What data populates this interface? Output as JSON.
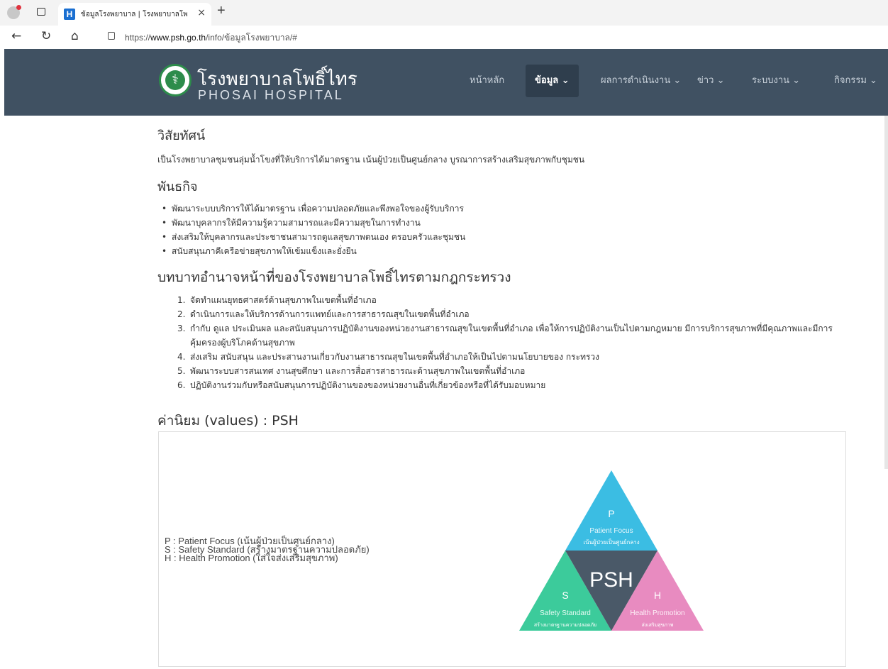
{
  "browser": {
    "tab_title": "ข้อมูลโรงพยาบาล | โรงพยาบาลโพธิ์ไทร",
    "tab_close": "×",
    "new_tab": "+",
    "url_prefix": "https://",
    "url_domain": "www.psh.go.th",
    "url_path": "/info/ข้อมูลโรงพยาบาล/#"
  },
  "header": {
    "brand_th": "โรงพยาบาลโพธิ์ไทร",
    "brand_en": "PHOSAI HOSPITAL",
    "menu": [
      {
        "label": "หน้าหลัก"
      },
      {
        "label": "ข้อมูล ⌄"
      },
      {
        "label": "ผลการดำเนินงาน ⌄"
      },
      {
        "label": "ข่าว ⌄"
      },
      {
        "label": "ระบบงาน ⌄"
      },
      {
        "label": "กิจกรรม ⌄"
      }
    ]
  },
  "vision": {
    "heading": "วิสัยทัศน์",
    "text": "เป็นโรงพยาบาลชุมชนลุ่มน้ำโขงที่ให้บริการได้มาตรฐาน เน้นผู้ป่วยเป็นศูนย์กลาง บูรณาการสร้างเสริมสุขภาพกับชุมชน"
  },
  "mission": {
    "heading": "พันธกิจ",
    "items": [
      "พัฒนาระบบบริการให้ได้มาตรฐาน เพื่อความปลอดภัยและพึงพอใจของผู้รับบริการ",
      "พัฒนาบุคลากรให้มีความรู้ความสามารถและมีความสุขในการทำงาน",
      "ส่งเสริมให้บุคลากรและประชาชนสามารถดูแลสุขภาพตนเอง ครอบครัวและชุมชน",
      "สนับสนุนภาคีเครือข่ายสุขภาพให้เข้มแข็งและยั่งยืน"
    ]
  },
  "roles": {
    "heading": "บทบาทอำนาจหน้าที่ของโรงพยาบาลโพธิ์ไทรตามกฎกระทรวง",
    "items": [
      {
        "num": "1.",
        "text": "จัดทำแผนยุทธศาสตร์ด้านสุขภาพในเขตพื้นที่อำเภอ"
      },
      {
        "num": "2.",
        "text": "ดำเนินการและให้บริการด้านการแพทย์และการสาธารณสุขในเขตพื้นที่อำเภอ"
      },
      {
        "num": "3.",
        "text": "กำกับ ดูแล ประเมินผล และสนับสนุนการปฏิบัติงานของหน่วยงานสาธารณสุขในเขตพื้นที่อำเภอ เพื่อให้การปฏิบัติงานเป็นไปตามกฎหมาย มีการบริการสุขภาพที่มีคุณภาพและมีการคุ้มครองผู้บริโภคด้านสุขภาพ"
      },
      {
        "num": "4.",
        "text": "ส่งเสริม สนับสนุน และประสานงานเกี่ยวกับงานสาธารณสุขในเขตพื้นที่อำเภอให้เป็นไปตามนโยบายของ กระทรวง"
      },
      {
        "num": "5.",
        "text": "พัฒนาระบบสารสนเทศ งานสุขศึกษา และการสื่อสารสาธารณะด้านสุขภาพในเขตพื้นที่อำเภอ"
      },
      {
        "num": "6.",
        "text": "ปฏิบัติงานร่วมกับหรือสนับสนุนการปฏิบัติงานของของหน่วยงานอื่นที่เกี่ยวข้องหรือที่ได้รับมอบหมาย"
      }
    ]
  },
  "values": {
    "heading": "ค่านิยม (values)  :  PSH",
    "lines": [
      "P : Patient Focus (เน้นผู้ป่วยเป็นศูนย์กลาง)",
      "S : Safety Standard (สร้างมาตรฐานความปลอดภัย)",
      "H : Health Promotion (ใส่ใจส่งเสริมสุขภาพ)"
    ],
    "diagram": {
      "center": "PSH",
      "p_letter": "P",
      "p_title": "Patient Focus",
      "p_sub": "เน้นผู้ป่วยเป็นศูนย์กลาง",
      "s_letter": "S",
      "s_title": "Safety Standard",
      "s_sub": "สร้างมาตรฐานความปลอดภัย",
      "h_letter": "H",
      "h_title": "Health Promotion",
      "h_sub": "ส่งเสริมสุขภาพ",
      "colors": {
        "p": "#3bbde3",
        "s": "#3ccb9b",
        "h": "#e88bc0",
        "center": "#4a5968"
      }
    }
  }
}
